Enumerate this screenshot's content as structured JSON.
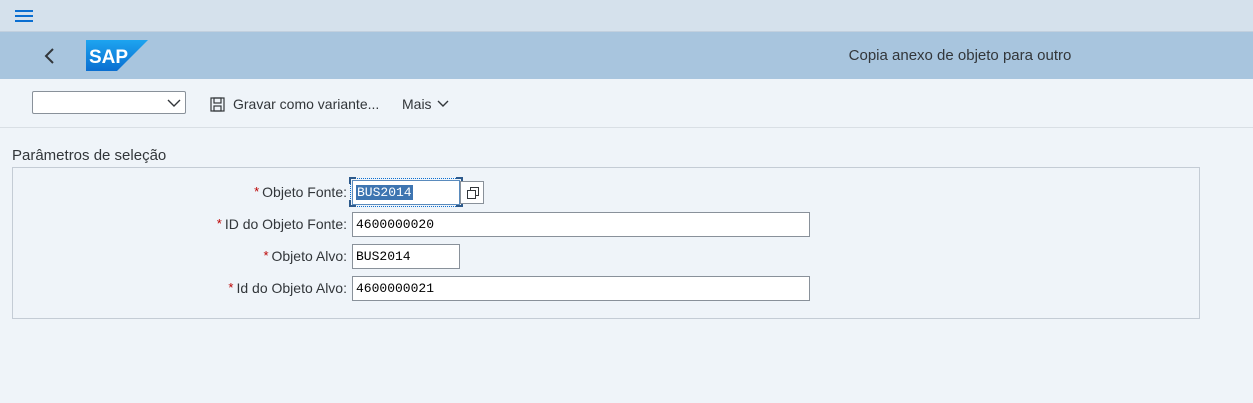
{
  "menu": {
    "icon": "hamburger-menu-icon"
  },
  "shell": {
    "back_icon": "chevron-left-icon",
    "logo_text": "SAP",
    "title": "Copia anexo de objeto para outro"
  },
  "toolbar": {
    "variant_value": "",
    "save_variant_label": "Gravar como variante...",
    "more_label": "Mais"
  },
  "selection": {
    "title": "Parâmetros de seleção",
    "fields": [
      {
        "label": "Objeto Fonte:",
        "value": "BUS2014",
        "required": true
      },
      {
        "label": "ID do Objeto Fonte:",
        "value": "4600000020",
        "required": true
      },
      {
        "label": "Objeto Alvo:",
        "value": "BUS2014",
        "required": true
      },
      {
        "label": "Id do Objeto Alvo:",
        "value": "4600000021",
        "required": true
      }
    ],
    "required_marker": "*"
  },
  "colors": {
    "accent": "#0a6ed1",
    "shell_bar": "#a8c5de",
    "menu_bar": "#d5e1ec",
    "background": "#eff4f9",
    "required": "#bb0000"
  }
}
